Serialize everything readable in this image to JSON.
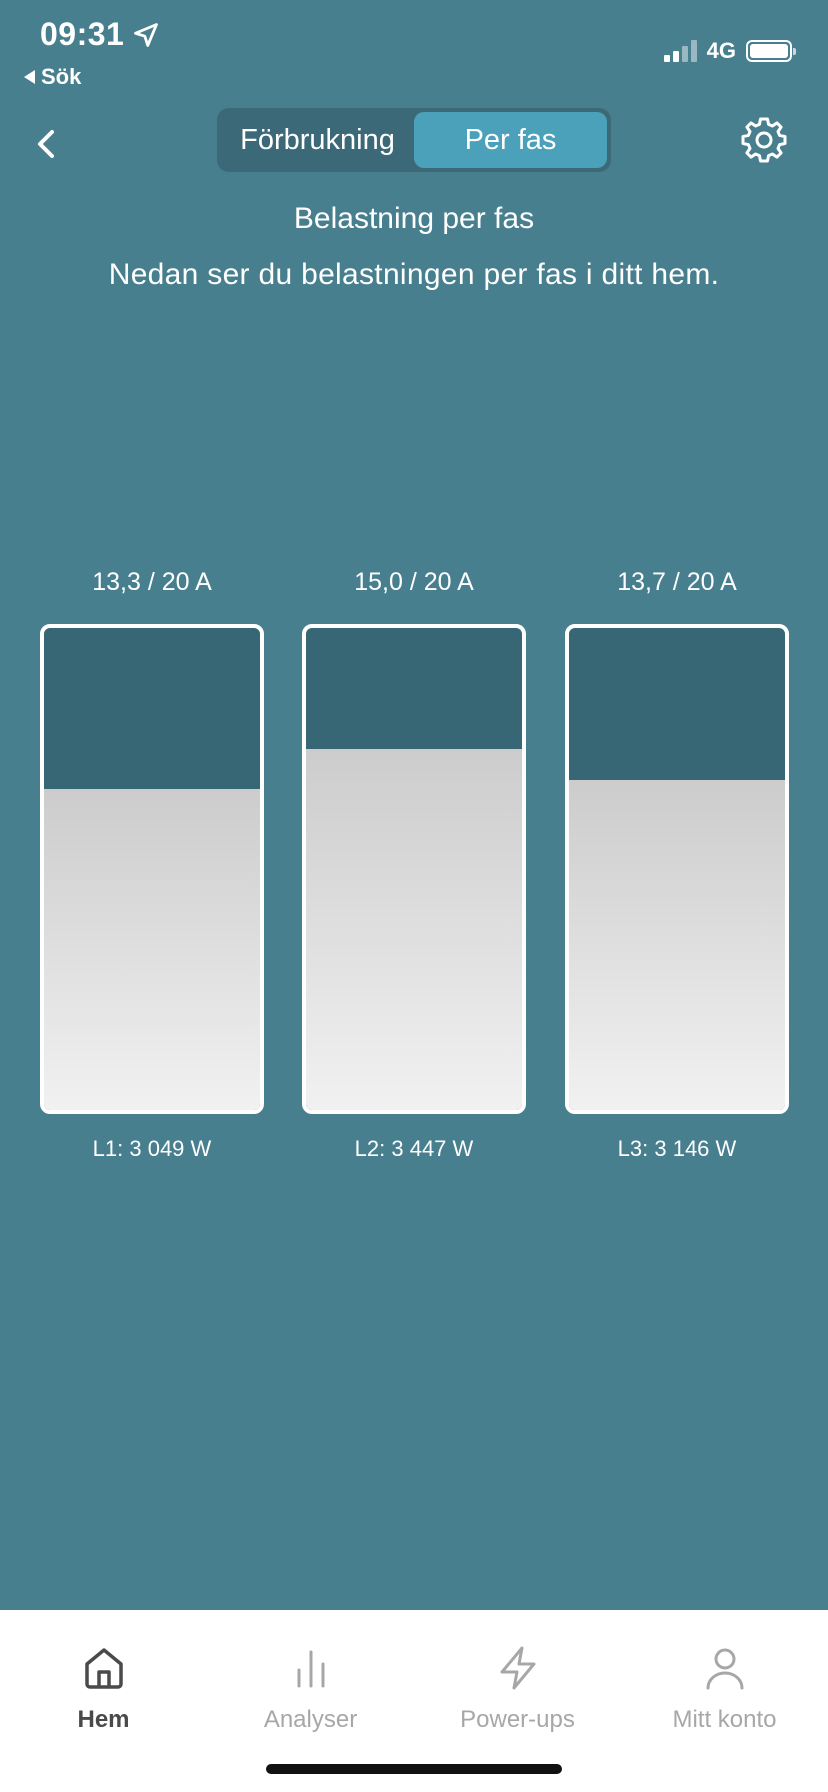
{
  "status_bar": {
    "time": "09:31",
    "back_label": "Sök",
    "network": "4G"
  },
  "header": {
    "segments": [
      "Förbrukning",
      "Per fas"
    ],
    "active_segment": 1
  },
  "title": "Belastning per fas",
  "subtitle": "Nedan ser du belastningen per fas i ditt hem.",
  "phases": [
    {
      "amp_label": "13,3 / 20 A",
      "power_label": "L1: 3 049 W",
      "current": 13.3,
      "max": 20
    },
    {
      "amp_label": "15,0 / 20 A",
      "power_label": "L2: 3 447 W",
      "current": 15.0,
      "max": 20
    },
    {
      "amp_label": "13,7 / 20 A",
      "power_label": "L3: 3 146 W",
      "current": 13.7,
      "max": 20
    }
  ],
  "tabbar": {
    "items": [
      {
        "label": "Hem",
        "icon": "home-icon",
        "active": true
      },
      {
        "label": "Analyser",
        "icon": "bar-chart-icon",
        "active": false
      },
      {
        "label": "Power-ups",
        "icon": "lightning-icon",
        "active": false
      },
      {
        "label": "Mitt konto",
        "icon": "user-icon",
        "active": false
      }
    ]
  },
  "colors": {
    "background": "#477f8f",
    "segment_active": "#4ba1b9",
    "bar_empty": "#376774",
    "bar_fill": "#e0dfe0",
    "tab_active": "#4a4a4a",
    "tab_inactive": "#a7a7a7"
  }
}
